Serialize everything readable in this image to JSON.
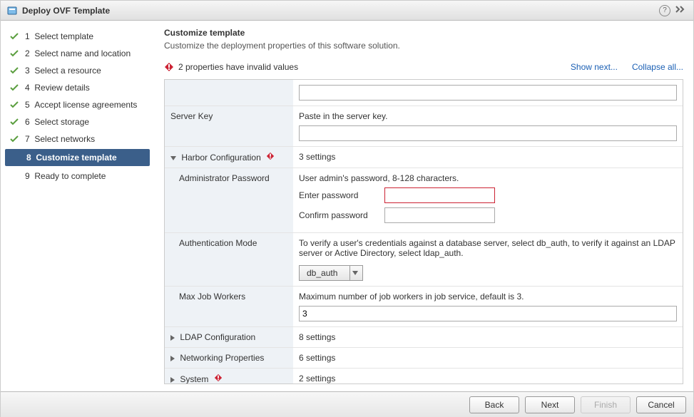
{
  "header": {
    "title": "Deploy OVF Template"
  },
  "sidebar": {
    "steps": [
      {
        "num": "1",
        "label": "Select template",
        "state": "done"
      },
      {
        "num": "2",
        "label": "Select name and location",
        "state": "done"
      },
      {
        "num": "3",
        "label": "Select a resource",
        "state": "done"
      },
      {
        "num": "4",
        "label": "Review details",
        "state": "done"
      },
      {
        "num": "5",
        "label": "Accept license agreements",
        "state": "done"
      },
      {
        "num": "6",
        "label": "Select storage",
        "state": "done"
      },
      {
        "num": "7",
        "label": "Select networks",
        "state": "done"
      },
      {
        "num": "8",
        "label": "Customize template",
        "state": "active"
      },
      {
        "num": "9",
        "label": "Ready to complete",
        "state": "pending"
      }
    ]
  },
  "main": {
    "title": "Customize template",
    "subtitle": "Customize the deployment properties of this software solution.",
    "alert_text": "2 properties have invalid values",
    "show_next": "Show next...",
    "collapse_all": "Collapse all...",
    "server_key_label": "Server Key",
    "server_key_desc": "Paste in the server key.",
    "server_key_value": "",
    "harbor_label": "Harbor Configuration",
    "harbor_settings": "3 settings",
    "admin_pw_label": "Administrator Password",
    "admin_pw_desc": "User admin's password, 8-128 characters.",
    "enter_password_label": "Enter password",
    "confirm_password_label": "Confirm password",
    "enter_password_value": "",
    "confirm_password_value": "",
    "auth_mode_label": "Authentication Mode",
    "auth_mode_desc": "To verify a user's credentials against a database server, select db_auth, to verify it against an LDAP server or Active Directory, select ldap_auth.",
    "auth_mode_value": "db_auth",
    "max_workers_label": "Max Job Workers",
    "max_workers_desc": "Maximum number of job workers in job service, default is 3.",
    "max_workers_value": "3",
    "ldap_label": "LDAP Configuration",
    "ldap_settings": "8 settings",
    "net_label": "Networking Properties",
    "net_settings": "6 settings",
    "system_label": "System",
    "system_settings": "2 settings"
  },
  "footer": {
    "back": "Back",
    "next": "Next",
    "finish": "Finish",
    "cancel": "Cancel"
  }
}
